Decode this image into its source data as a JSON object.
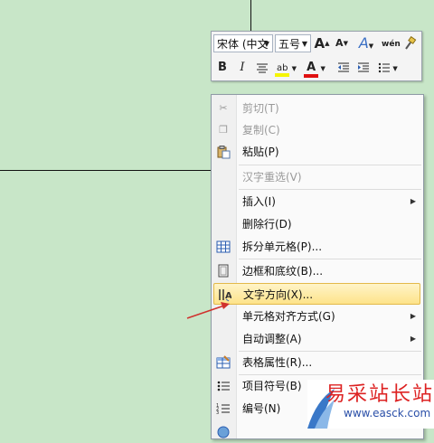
{
  "mini_toolbar": {
    "font_name": "宋体 (中文",
    "font_size": "五号",
    "grow_font_icon": "A",
    "shrink_font_icon": "A",
    "styles_icon": "A",
    "phonetic_icon": "wén",
    "bold": "B",
    "italic": "I",
    "text_color_icon": "A"
  },
  "context_menu": {
    "items": [
      {
        "label": "剪切(T)",
        "enabled": false,
        "icon": "cut-icon"
      },
      {
        "label": "复制(C)",
        "enabled": false,
        "icon": "copy-icon"
      },
      {
        "label": "粘贴(P)",
        "enabled": true,
        "icon": "paste-icon"
      },
      {
        "label": "汉字重选(V)",
        "enabled": false
      },
      {
        "label": "插入(I)",
        "enabled": true,
        "submenu": true
      },
      {
        "label": "删除行(D)",
        "enabled": true
      },
      {
        "label": "拆分单元格(P)...",
        "enabled": true,
        "icon": "split-cells-icon"
      },
      {
        "label": "边框和底纹(B)...",
        "enabled": true,
        "icon": "borders-icon"
      },
      {
        "label": "文字方向(X)...",
        "enabled": true,
        "icon": "text-direction-icon",
        "highlighted": true
      },
      {
        "label": "单元格对齐方式(G)",
        "enabled": true,
        "submenu": true
      },
      {
        "label": "自动调整(A)",
        "enabled": true,
        "submenu": true
      },
      {
        "label": "表格属性(R)...",
        "enabled": true,
        "icon": "table-properties-icon"
      },
      {
        "label": "项目符号(B)",
        "enabled": true,
        "icon": "bullets-icon"
      },
      {
        "label": "编号(N)",
        "enabled": true,
        "icon": "numbering-icon"
      }
    ]
  },
  "watermark": {
    "title": "易采站长站",
    "url": "www.easck.com"
  },
  "colors": {
    "background": "#c8e6c8",
    "highlight": "#fde38a",
    "arrow": "#d0312d"
  }
}
